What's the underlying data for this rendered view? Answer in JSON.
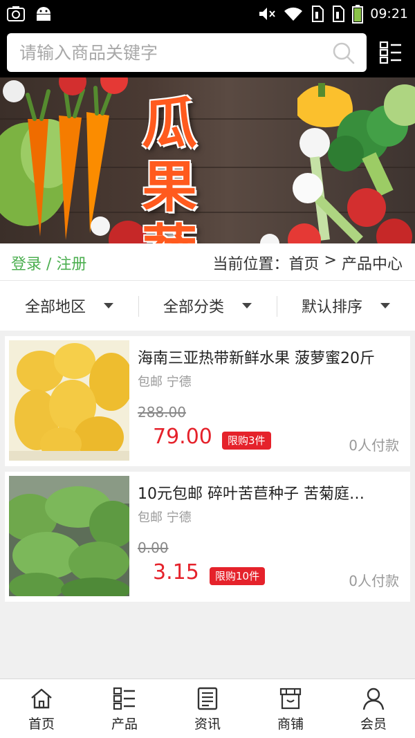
{
  "status_bar": {
    "time": "09:21",
    "icons": [
      "screenshot-icon",
      "android-icon",
      "mute-icon",
      "wifi-icon",
      "sim1-icon",
      "sim2-icon",
      "battery-icon"
    ]
  },
  "search": {
    "placeholder": "请输入商品关键字"
  },
  "banner": {
    "line1": "瓜果",
    "line2": "蔬菜"
  },
  "breadcrumb": {
    "login": "登录",
    "separator": " / ",
    "register": "注册",
    "location_label": "当前位置：",
    "home": "首页",
    "arrow": " > ",
    "current": "产品中心"
  },
  "filters": [
    {
      "label": "全部地区"
    },
    {
      "label": "全部分类"
    },
    {
      "label": "默认排序"
    }
  ],
  "products": [
    {
      "title": "海南三亚热带新鲜水果 菠萝蜜20斤",
      "shipping": "包邮",
      "city": "宁德",
      "old_price": "288.00",
      "price": "79.00",
      "limit": "限购3件",
      "paid": "0人付款"
    },
    {
      "title": "10元包邮 碎叶苦苣种子 苦菊庭…",
      "shipping": "包邮",
      "city": "宁德",
      "old_price": "0.00",
      "price": "3.15",
      "limit": "限购10件",
      "paid": "0人付款"
    }
  ],
  "tabbar": [
    {
      "label": "首页",
      "icon": "home-icon"
    },
    {
      "label": "产品",
      "icon": "product-grid-icon"
    },
    {
      "label": "资讯",
      "icon": "news-icon"
    },
    {
      "label": "商铺",
      "icon": "store-icon"
    },
    {
      "label": "会员",
      "icon": "member-icon"
    }
  ],
  "colors": {
    "accent_green": "#4caf50",
    "price_red": "#e5222b",
    "banner_text": "#ff5a1e"
  }
}
